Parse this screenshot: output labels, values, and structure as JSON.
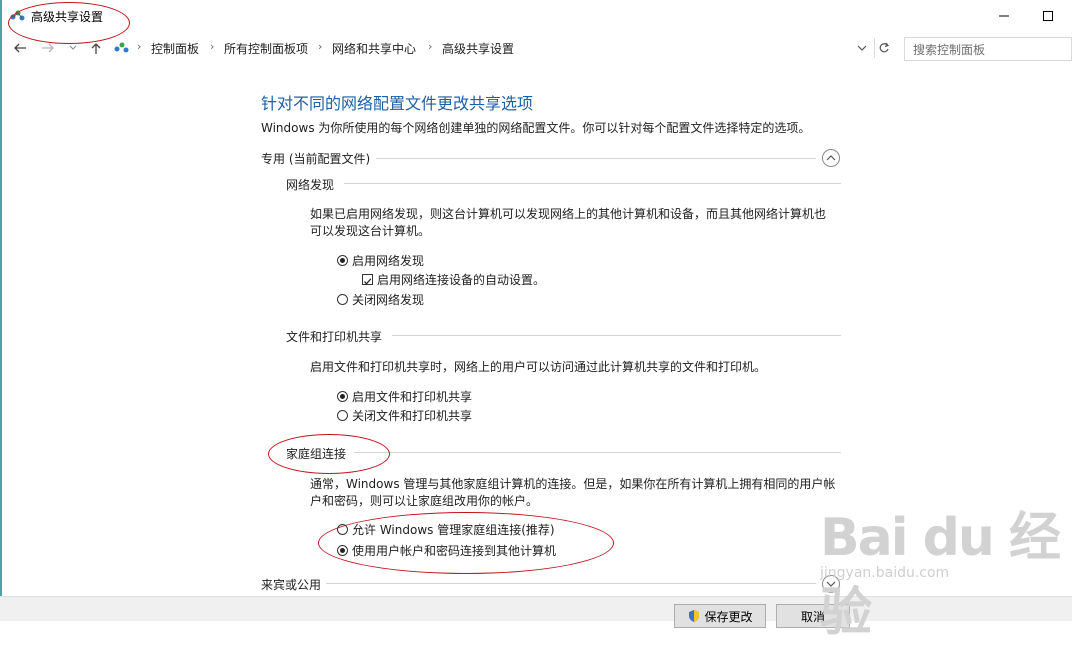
{
  "window": {
    "title": "高级共享设置"
  },
  "breadcrumb": {
    "items": [
      "控制面板",
      "所有控制面板项",
      "网络和共享中心",
      "高级共享设置"
    ]
  },
  "search": {
    "placeholder": "搜索控制面板"
  },
  "page": {
    "heading": "针对不同的网络配置文件更改共享选项",
    "description": "Windows 为你所使用的每个网络创建单独的网络配置文件。你可以针对每个配置文件选择特定的选项。"
  },
  "profile_private": {
    "title": "专用 (当前配置文件)",
    "network_discovery": {
      "title": "网络发现",
      "description_line1": "如果已启用网络发现，则这台计算机可以发现网络上的其他计算机和设备，而且其他网络计算机也",
      "description_line2": "可以发现这台计算机。",
      "option_on": "启用网络发现",
      "option_auto": "启用网络连接设备的自动设置。",
      "option_off": "关闭网络发现"
    },
    "file_printer": {
      "title": "文件和打印机共享",
      "description": "启用文件和打印机共享时，网络上的用户可以访问通过此计算机共享的文件和打印机。",
      "option_on": "启用文件和打印机共享",
      "option_off": "关闭文件和打印机共享"
    },
    "homegroup": {
      "title": "家庭组连接",
      "description_line1": "通常，Windows 管理与其他家庭组计算机的连接。但是，如果你在所有计算机上拥有相同的用户帐",
      "description_line2": "户和密码，则可以让家庭组改用你的帐户。",
      "option_windows": "允许 Windows 管理家庭组连接(推荐)",
      "option_account": "使用用户帐户和密码连接到其他计算机"
    }
  },
  "profile_guest": {
    "title": "来宾或公用"
  },
  "footer": {
    "save_label": "保存更改",
    "cancel_label": "取消"
  },
  "watermark": {
    "brand": "Bai du 经验",
    "url": "jingyan.baidu.com"
  }
}
